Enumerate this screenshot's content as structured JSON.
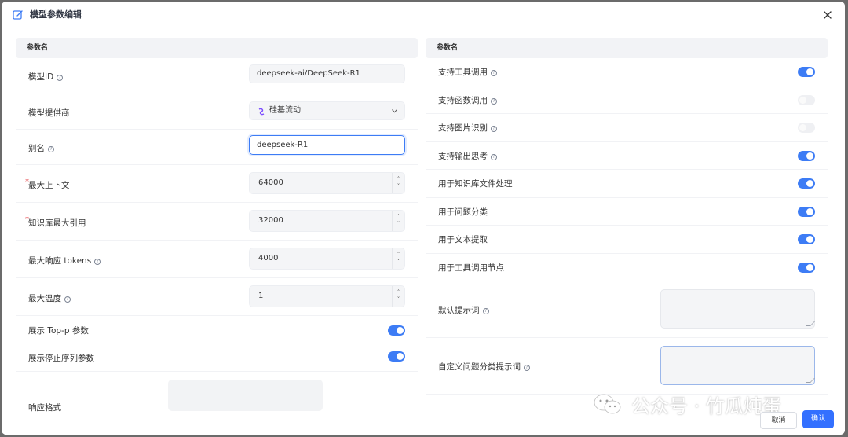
{
  "modal": {
    "title": "模型参数编辑"
  },
  "left": {
    "section_label": "参数名",
    "model_id": {
      "label": "模型ID",
      "value": "deepseek-ai/DeepSeek-R1"
    },
    "provider": {
      "label": "模型提供商",
      "value": "硅基流动"
    },
    "alias": {
      "label": "别名",
      "value": "deepseek-R1"
    },
    "max_context": {
      "label": "最大上下文",
      "value": "64000"
    },
    "kb_max_ref": {
      "label": "知识库最大引用",
      "value": "32000"
    },
    "max_response": {
      "label": "最大响应 tokens",
      "value": "4000"
    },
    "max_temp": {
      "label": "最大温度",
      "value": "1"
    },
    "show_topp": {
      "label": "展示 Top-p 参数",
      "on": true
    },
    "show_stop": {
      "label": "展示停止序列参数",
      "on": true
    },
    "response_format": {
      "label": "响应格式"
    }
  },
  "right": {
    "section_label": "参数名",
    "toggles": [
      {
        "label": "支持工具调用",
        "help": true,
        "on": true
      },
      {
        "label": "支持函数调用",
        "help": true,
        "on": false
      },
      {
        "label": "支持图片识别",
        "help": true,
        "on": false
      },
      {
        "label": "支持输出思考",
        "help": true,
        "on": true
      },
      {
        "label": "用于知识库文件处理",
        "help": false,
        "on": true
      },
      {
        "label": "用于问题分类",
        "help": false,
        "on": true
      },
      {
        "label": "用于文本提取",
        "help": false,
        "on": true
      },
      {
        "label": "用于工具调用节点",
        "help": false,
        "on": true
      }
    ],
    "default_prompt": {
      "label": "默认提示词"
    },
    "custom_classify_prompt": {
      "label": "自定义问题分类提示词"
    }
  },
  "footer": {
    "cancel": "取消",
    "confirm": "确认"
  },
  "watermark": "公众号 · 竹瓜炖蛋",
  "colors": {
    "accent": "#3d7cf5",
    "primary_button": "#3370ff",
    "required": "#e5484d"
  }
}
